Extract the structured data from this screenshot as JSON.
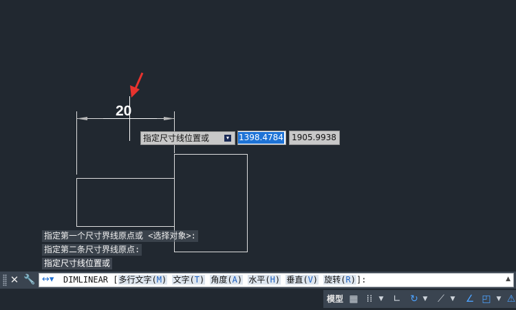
{
  "drawing": {
    "dimension_text": "20"
  },
  "dynamic_input": {
    "prompt": "指定尺寸线位置或",
    "dropdown_icon": "down-arrow-icon",
    "x_value": "1398.4784",
    "y_value": "1905.9938"
  },
  "command_history": [
    "指定第一个尺寸界线原点或 <选择对象>:",
    "指定第二条尺寸界线原点:",
    "指定尺寸线位置或"
  ],
  "command_line": {
    "command": "DIMLINEAR",
    "bracket_open": "[",
    "options": [
      {
        "label": "多行文字",
        "key": "M"
      },
      {
        "label": "文字",
        "key": "T"
      },
      {
        "label": "角度",
        "key": "A"
      },
      {
        "label": "水平",
        "key": "H"
      },
      {
        "label": "垂直",
        "key": "V"
      },
      {
        "label": "旋转",
        "key": "R"
      }
    ],
    "bracket_close": "]:"
  },
  "status_bar": {
    "model_label": "模型"
  },
  "colors": {
    "canvas_bg": "#212830",
    "red_arrow": "#e8332e",
    "highlight": "#1e73d6"
  }
}
